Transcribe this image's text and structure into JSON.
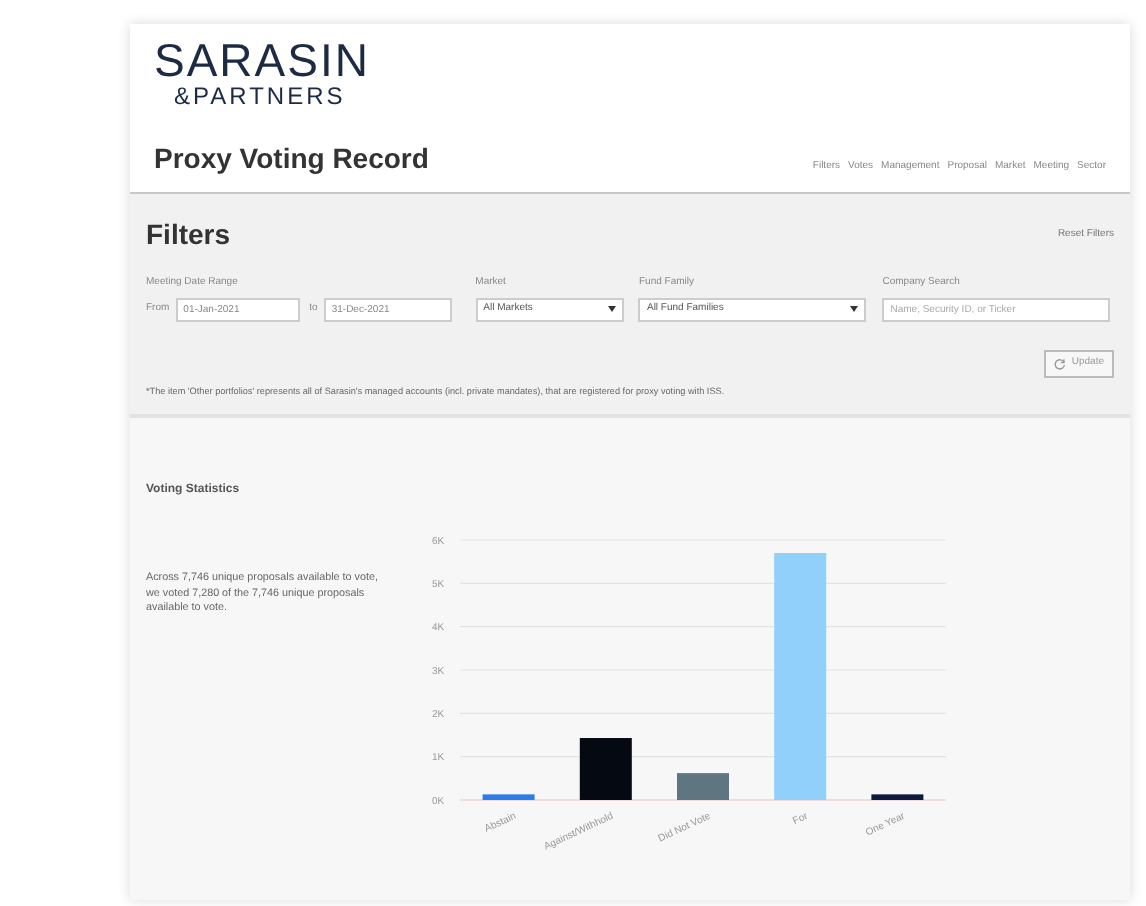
{
  "logo": {
    "name": "SARASIN",
    "sub": "&PARTNERS"
  },
  "page_title": "Proxy Voting Record",
  "nav": [
    "Filters",
    "Votes",
    "Management",
    "Proposal",
    "Market",
    "Meeting",
    "Sector"
  ],
  "filters": {
    "title": "Filters",
    "reset": "Reset Filters",
    "date_range": {
      "label": "Meeting Date Range",
      "from_label": "From",
      "from": "01-Jan-2021",
      "to_label": "to",
      "to": "31-Dec-2021"
    },
    "market": {
      "label": "Market",
      "value": "All Markets"
    },
    "fund_family": {
      "label": "Fund Family",
      "value": "All Fund Families"
    },
    "company_search": {
      "label": "Company Search",
      "placeholder": "Name, Security ID, or Ticker"
    },
    "update_button": "Update",
    "note": "*The item 'Other portfolios' represents all of Sarasin's managed accounts (incl. private mandates), that are registered for proxy voting with ISS."
  },
  "voting_statistics": {
    "title": "Voting Statistics",
    "summary": "Across 7,746 unique proposals available to vote, we voted 7,280 of the 7,746 unique proposals available to vote.",
    "chart_data": {
      "type": "bar",
      "categories": [
        "Abstain",
        "Against/Withhold",
        "Did Not Vote",
        "For",
        "One Year"
      ],
      "values": [
        130,
        1430,
        620,
        5700,
        130
      ],
      "colors": [
        "#2b7de9",
        "#050a12",
        "#5f7680",
        "#90d0fb",
        "#0c1a3d"
      ],
      "grid": true,
      "ylim": [
        0,
        6000
      ],
      "yticks": [
        {
          "value": 0,
          "label": "0K"
        },
        {
          "value": 1000,
          "label": "1K"
        },
        {
          "value": 2000,
          "label": "2K"
        },
        {
          "value": 3000,
          "label": "3K"
        },
        {
          "value": 4000,
          "label": "4K"
        },
        {
          "value": 5000,
          "label": "5K"
        },
        {
          "value": 6000,
          "label": "6K"
        }
      ]
    }
  }
}
